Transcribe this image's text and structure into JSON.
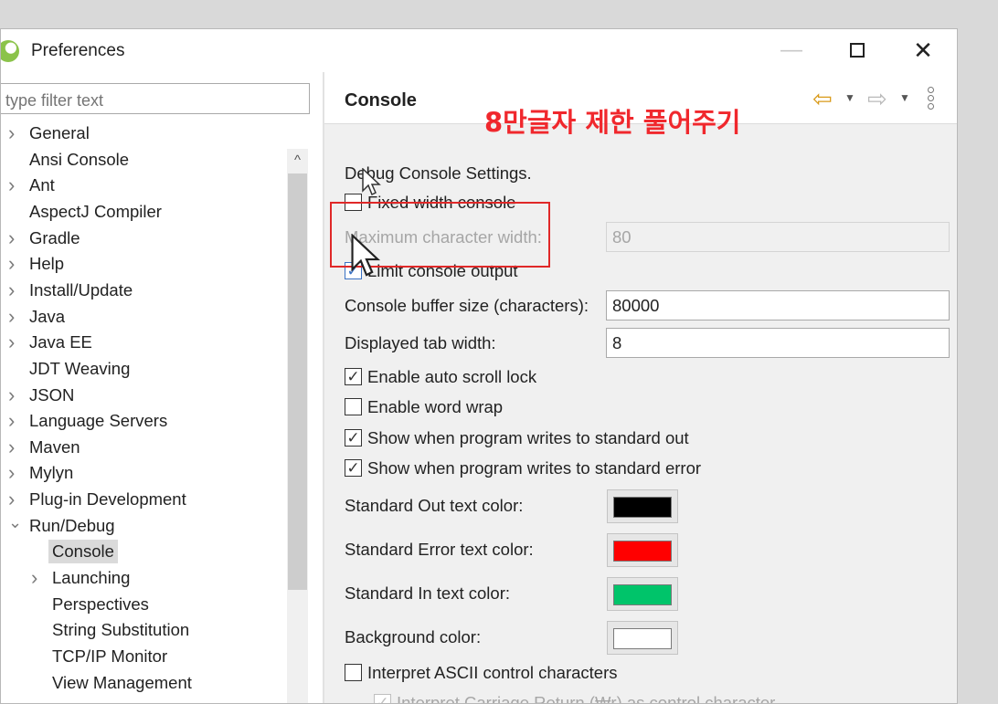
{
  "window": {
    "title": "Preferences"
  },
  "filter": {
    "placeholder": "type filter text"
  },
  "tree": {
    "items": [
      {
        "label": "General",
        "arrow": "right"
      },
      {
        "label": "Ansi Console",
        "arrow": ""
      },
      {
        "label": "Ant",
        "arrow": "right"
      },
      {
        "label": "AspectJ Compiler",
        "arrow": ""
      },
      {
        "label": "Gradle",
        "arrow": "right"
      },
      {
        "label": "Help",
        "arrow": "right"
      },
      {
        "label": "Install/Update",
        "arrow": "right"
      },
      {
        "label": "Java",
        "arrow": "right"
      },
      {
        "label": "Java EE",
        "arrow": "right"
      },
      {
        "label": "JDT Weaving",
        "arrow": ""
      },
      {
        "label": "JSON",
        "arrow": "right"
      },
      {
        "label": "Language Servers",
        "arrow": "right"
      },
      {
        "label": "Maven",
        "arrow": "right"
      },
      {
        "label": "Mylyn",
        "arrow": "right"
      },
      {
        "label": "Plug-in Development",
        "arrow": "right"
      },
      {
        "label": "Run/Debug",
        "arrow": "down"
      },
      {
        "label": "Console",
        "arrow": "",
        "child": true,
        "selected": true
      },
      {
        "label": "Launching",
        "arrow": "right",
        "child": true
      },
      {
        "label": "Perspectives",
        "arrow": "",
        "child": true
      },
      {
        "label": "String Substitution",
        "arrow": "",
        "child": true
      },
      {
        "label": "TCP/IP Monitor",
        "arrow": "",
        "child": true
      },
      {
        "label": "View Management",
        "arrow": "",
        "child": true
      }
    ]
  },
  "page": {
    "title": "Console",
    "section_label": "Debug Console Settings.",
    "fixed_width_label": "Fixed width console",
    "fixed_width_checked": false,
    "max_width_label": "Maximum character width:",
    "max_width_value": "80",
    "limit_output_label": "Limit console output",
    "limit_output_checked": true,
    "buffer_label": "Console buffer size (characters):",
    "buffer_value": "80000",
    "tab_width_label": "Displayed tab width:",
    "tab_width_value": "8",
    "auto_scroll_label": "Enable auto scroll lock",
    "auto_scroll_checked": true,
    "word_wrap_label": "Enable word wrap",
    "word_wrap_checked": false,
    "show_out_label": "Show when program writes to standard out",
    "show_out_checked": true,
    "show_err_label": "Show when program writes to standard error",
    "show_err_checked": true,
    "std_out_color_label": "Standard Out text color:",
    "std_err_color_label": "Standard Error text color:",
    "std_in_color_label": "Standard In text color:",
    "bg_color_label": "Background color:",
    "ascii_label": "Interpret ASCII control characters",
    "ascii_checked": false,
    "cr_label": "Interpret Carriage Return (₩r) as control character",
    "cr_checked": true
  },
  "colors": {
    "std_out": "#000000",
    "std_err": "#ff0000",
    "std_in": "#00c46a",
    "background": "#ffffff",
    "highlight": "#e02828"
  },
  "annotation": {
    "text": "8만글자 제한 풀어주기"
  },
  "icons": {
    "back": "back-arrow-icon",
    "forward": "forward-arrow-icon",
    "menu": "view-menu-icon"
  }
}
